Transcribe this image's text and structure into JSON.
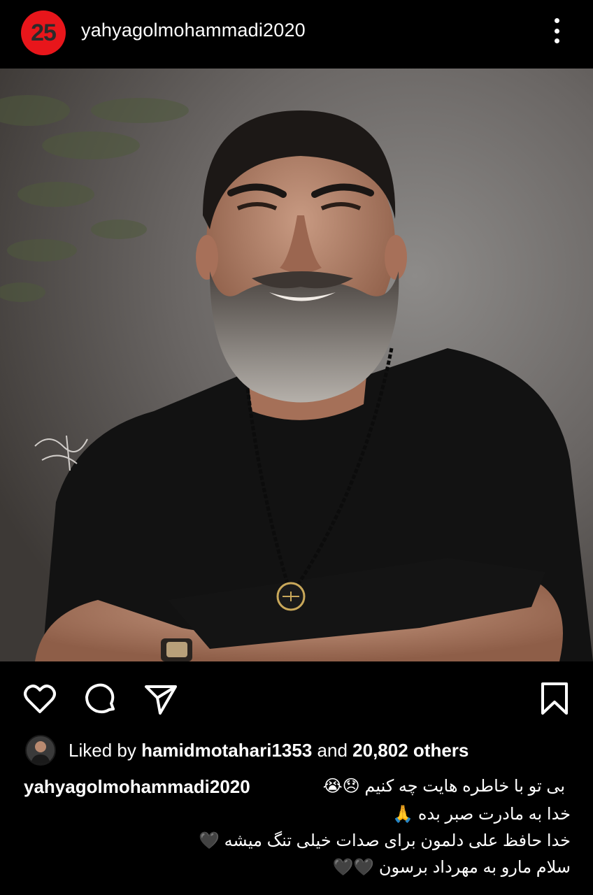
{
  "header": {
    "badge_number": "25",
    "username": "yahyagolmohammadi2020"
  },
  "post": {
    "photo_signature": "signature-watermark",
    "icons": [
      "heart-icon",
      "comment-icon",
      "share-icon",
      "bookmark-icon"
    ]
  },
  "likes": {
    "prefix": "Liked by",
    "user": "hamidmotahari1353",
    "middle": "and",
    "count": "20,802 others"
  },
  "caption": {
    "user": "yahyagolmohammadi2020",
    "line1": "بی تو با خاطره هایت چه کنیم 😞😭",
    "line2": "خدا به مادرت صبر بده 🙏",
    "line3": "خدا حافظ علی دلمون برای صدات خیلی تنگ میشه 🖤",
    "line4": "سلام مارو به مهرداد برسون 🖤🖤"
  },
  "colors": {
    "badge": "#e8161b",
    "background": "#000000",
    "text": "#ffffff"
  }
}
